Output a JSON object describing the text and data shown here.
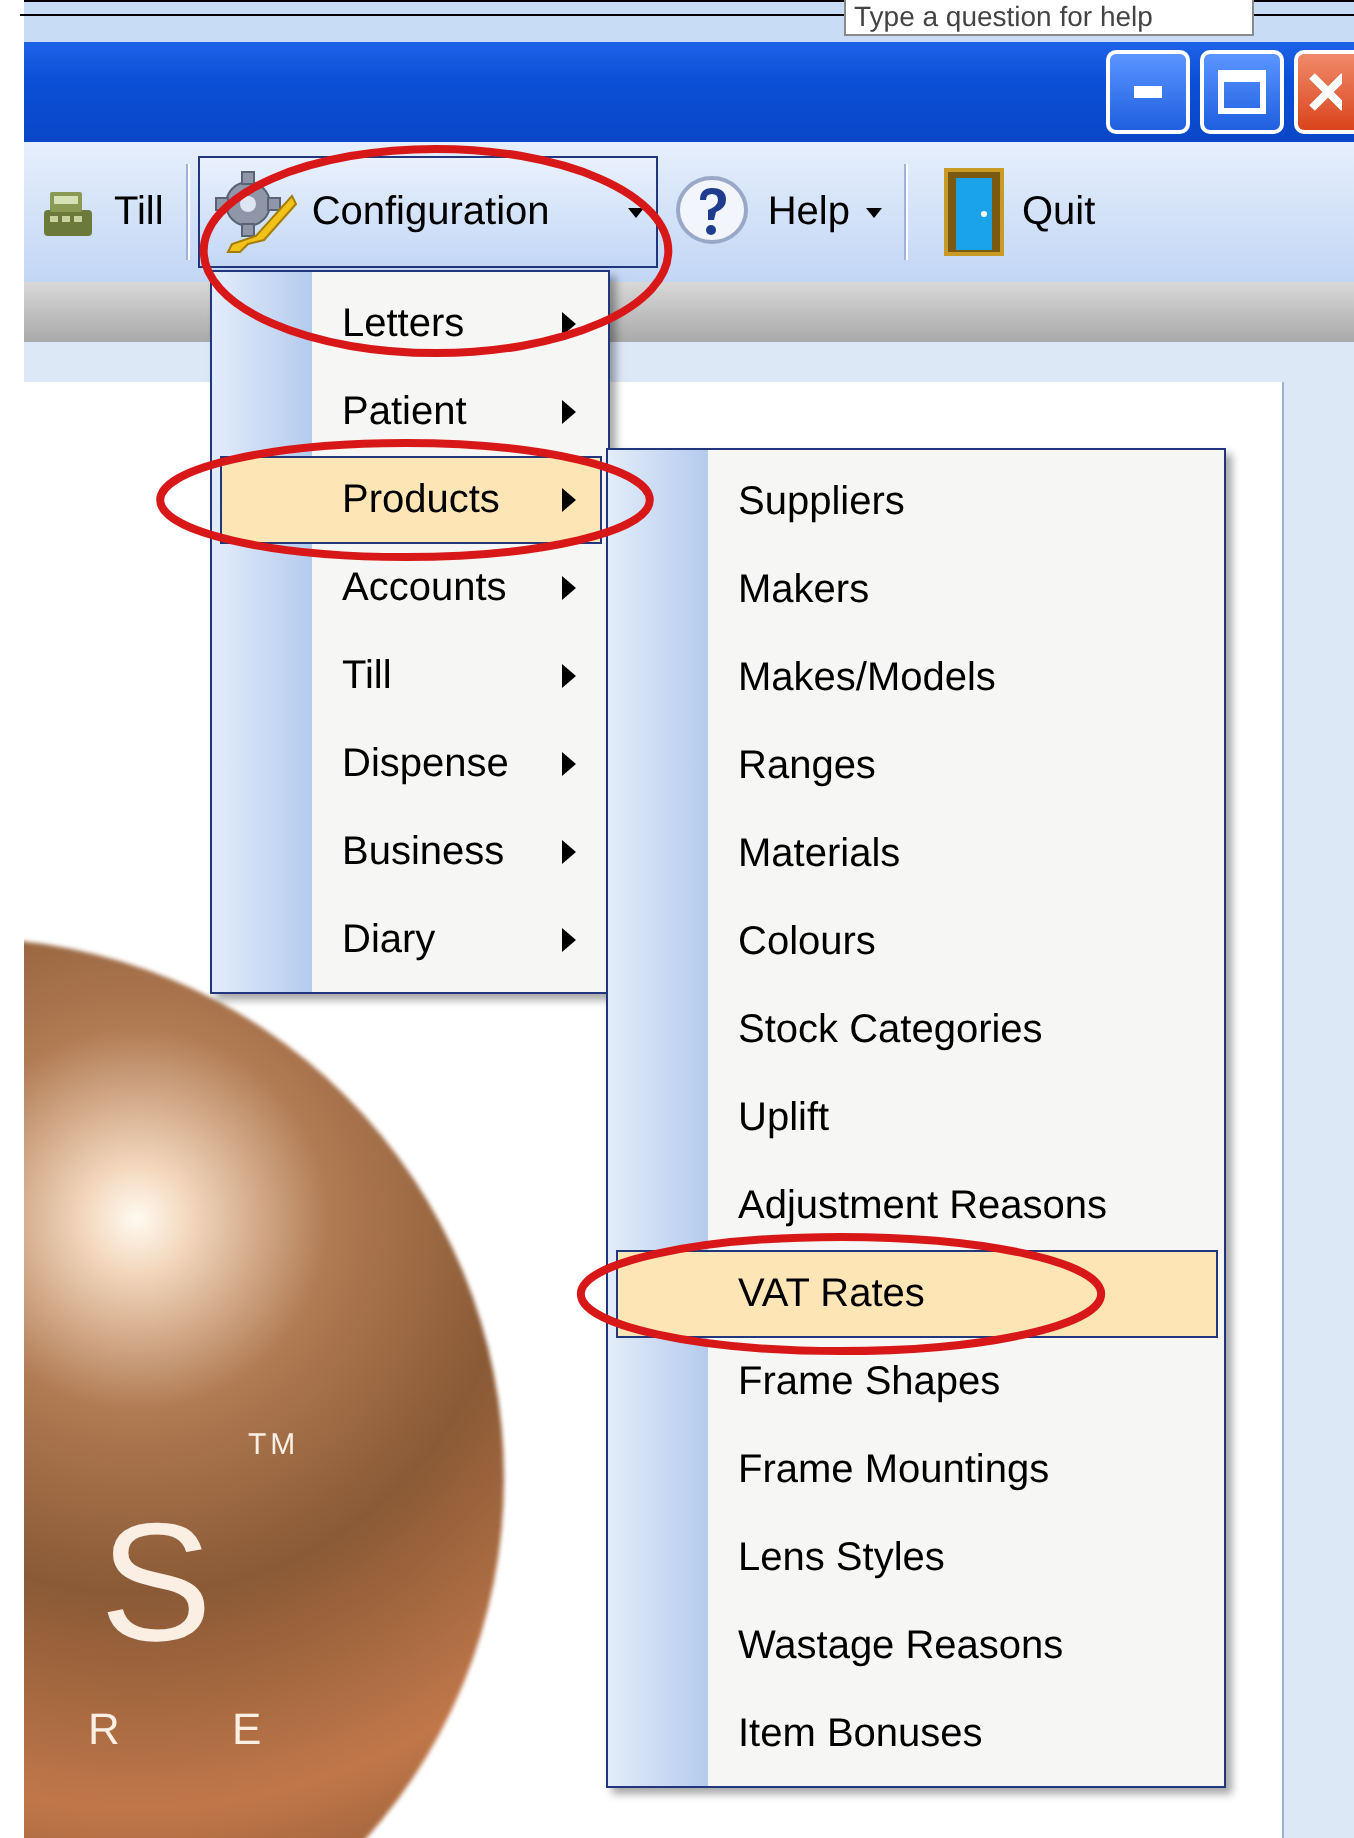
{
  "help_box": {
    "placeholder": "Type a question for help"
  },
  "toolbar": [
    {
      "kind": "button",
      "label": "Till",
      "pressed": false,
      "dropdown": false,
      "circled": false
    },
    {
      "kind": "separator"
    },
    {
      "kind": "button",
      "label": "Configuration",
      "pressed": true,
      "dropdown": true,
      "circled": true
    },
    {
      "kind": "button",
      "label": "Help",
      "pressed": false,
      "dropdown": true,
      "circled": false
    },
    {
      "kind": "separator"
    },
    {
      "kind": "button",
      "label": "Quit",
      "pressed": false,
      "dropdown": false,
      "circled": false
    }
  ],
  "configuration_menu": [
    {
      "label": "Letters",
      "submenu": true,
      "selected": false,
      "circled": false
    },
    {
      "label": "Patient",
      "submenu": true,
      "selected": false,
      "circled": false
    },
    {
      "label": "Products",
      "submenu": true,
      "selected": true,
      "circled": true
    },
    {
      "label": "Accounts",
      "submenu": true,
      "selected": false,
      "circled": false
    },
    {
      "label": "Till",
      "submenu": true,
      "selected": false,
      "circled": false
    },
    {
      "label": "Dispense",
      "submenu": true,
      "selected": false,
      "circled": false
    },
    {
      "label": "Business",
      "submenu": true,
      "selected": false,
      "circled": false
    },
    {
      "label": "Diary",
      "submenu": true,
      "selected": false,
      "circled": false
    }
  ],
  "products_menu": [
    {
      "label": "Suppliers",
      "submenu": false,
      "selected": false,
      "circled": false
    },
    {
      "label": "Makers",
      "submenu": false,
      "selected": false,
      "circled": false
    },
    {
      "label": "Makes/Models",
      "submenu": false,
      "selected": false,
      "circled": false
    },
    {
      "label": "Ranges",
      "submenu": false,
      "selected": false,
      "circled": false
    },
    {
      "label": "Materials",
      "submenu": false,
      "selected": false,
      "circled": false
    },
    {
      "label": "Colours",
      "submenu": false,
      "selected": false,
      "circled": false
    },
    {
      "label": "Stock Categories",
      "submenu": false,
      "selected": false,
      "circled": false
    },
    {
      "label": "Uplift",
      "submenu": false,
      "selected": false,
      "circled": false
    },
    {
      "label": "Adjustment Reasons",
      "submenu": false,
      "selected": false,
      "circled": false
    },
    {
      "label": "VAT Rates",
      "submenu": false,
      "selected": true,
      "circled": true
    },
    {
      "label": "Frame Shapes",
      "submenu": false,
      "selected": false,
      "circled": false
    },
    {
      "label": "Frame Mountings",
      "submenu": false,
      "selected": false,
      "circled": false
    },
    {
      "label": "Lens Styles",
      "submenu": false,
      "selected": false,
      "circled": false
    },
    {
      "label": "Wastage Reasons",
      "submenu": false,
      "selected": false,
      "circled": false
    },
    {
      "label": "Item Bonuses",
      "submenu": false,
      "selected": false,
      "circled": false
    }
  ],
  "logo": {
    "letters": "S",
    "trademark": "TM",
    "tagline": "R E"
  }
}
